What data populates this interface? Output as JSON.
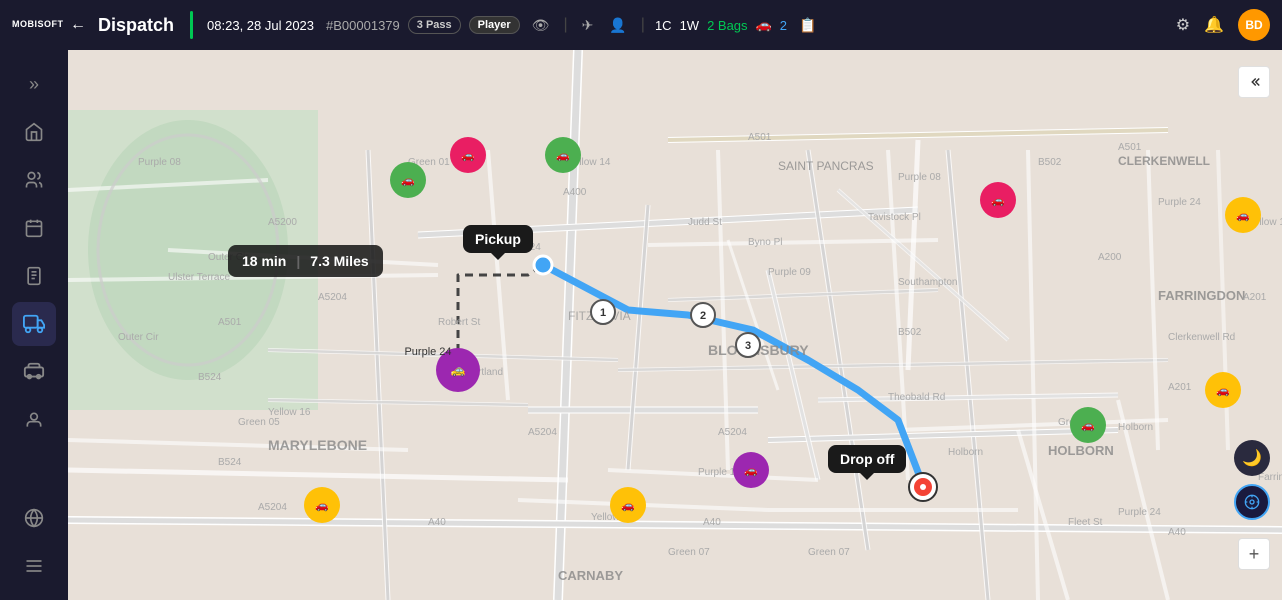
{
  "header": {
    "logo": "MOBISOFT",
    "back_label": "←",
    "title": "Dispatch",
    "time": "08:23, 28 Jul 2023",
    "booking_id": "#B00001379",
    "badge_pass": "3 Pass",
    "badge_player": "Player",
    "stat_1c": "1C",
    "stat_1w": "1W",
    "stat_bags": "2 Bags",
    "stat_vehicle": "2",
    "avatar": "BD"
  },
  "sidebar": {
    "expand_icon": "»",
    "items": [
      {
        "name": "home",
        "icon": "⌂",
        "active": false
      },
      {
        "name": "team",
        "icon": "⚇",
        "active": false
      },
      {
        "name": "calendar",
        "icon": "▦",
        "active": false
      },
      {
        "name": "dispatch-list",
        "icon": "⊟",
        "active": false
      },
      {
        "name": "vehicle",
        "icon": "🚗",
        "active": true
      },
      {
        "name": "car-alt",
        "icon": "🚕",
        "active": false
      },
      {
        "name": "person",
        "icon": "👤",
        "active": false
      },
      {
        "name": "settings",
        "icon": "⊕",
        "active": false
      },
      {
        "name": "menu",
        "icon": "☰",
        "active": false
      }
    ]
  },
  "map": {
    "route_time": "18 min",
    "route_miles": "7.3 Miles",
    "pickup_label": "Pickup",
    "dropoff_label": "Drop off",
    "purple24_label": "Purple 24",
    "area_labels": [
      "MARYLEBONE",
      "BLOOMSBURY",
      "FARRINGDON",
      "HOLBORN",
      "CLERKENWELL",
      "SAINT PANCRAS",
      "CARNABY",
      "FITZROVIA"
    ],
    "road_labels": [
      "A501",
      "A400",
      "A40",
      "A5204",
      "B502"
    ],
    "waypoints": [
      "1",
      "2",
      "3"
    ],
    "controls": {
      "dark_mode": "🌙",
      "location": "⊕",
      "zoom_plus": "+",
      "zoom_minus": "–"
    }
  }
}
